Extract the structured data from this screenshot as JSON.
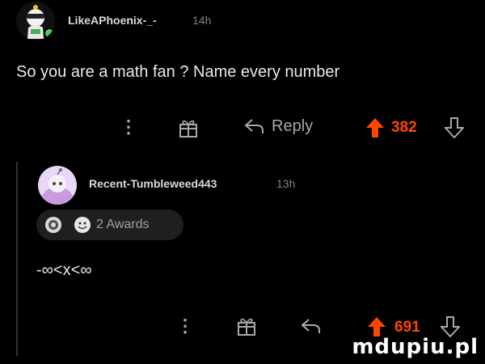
{
  "comment1": {
    "username": "LikeAPhoenix-_-",
    "time": "14h",
    "text": "So you are a math fan ? Name every number",
    "actions": {
      "reply_label": "Reply",
      "score": "382"
    }
  },
  "comment2": {
    "username": "Recent-Tumbleweed443",
    "time": "13h",
    "awards_label": "2 Awards",
    "text": "-∞<x<∞",
    "actions": {
      "score": "691"
    }
  },
  "watermark": "mdupiu.pl",
  "colors": {
    "background": "#000000",
    "upvote": "#ff4500",
    "online": "#46d160"
  }
}
